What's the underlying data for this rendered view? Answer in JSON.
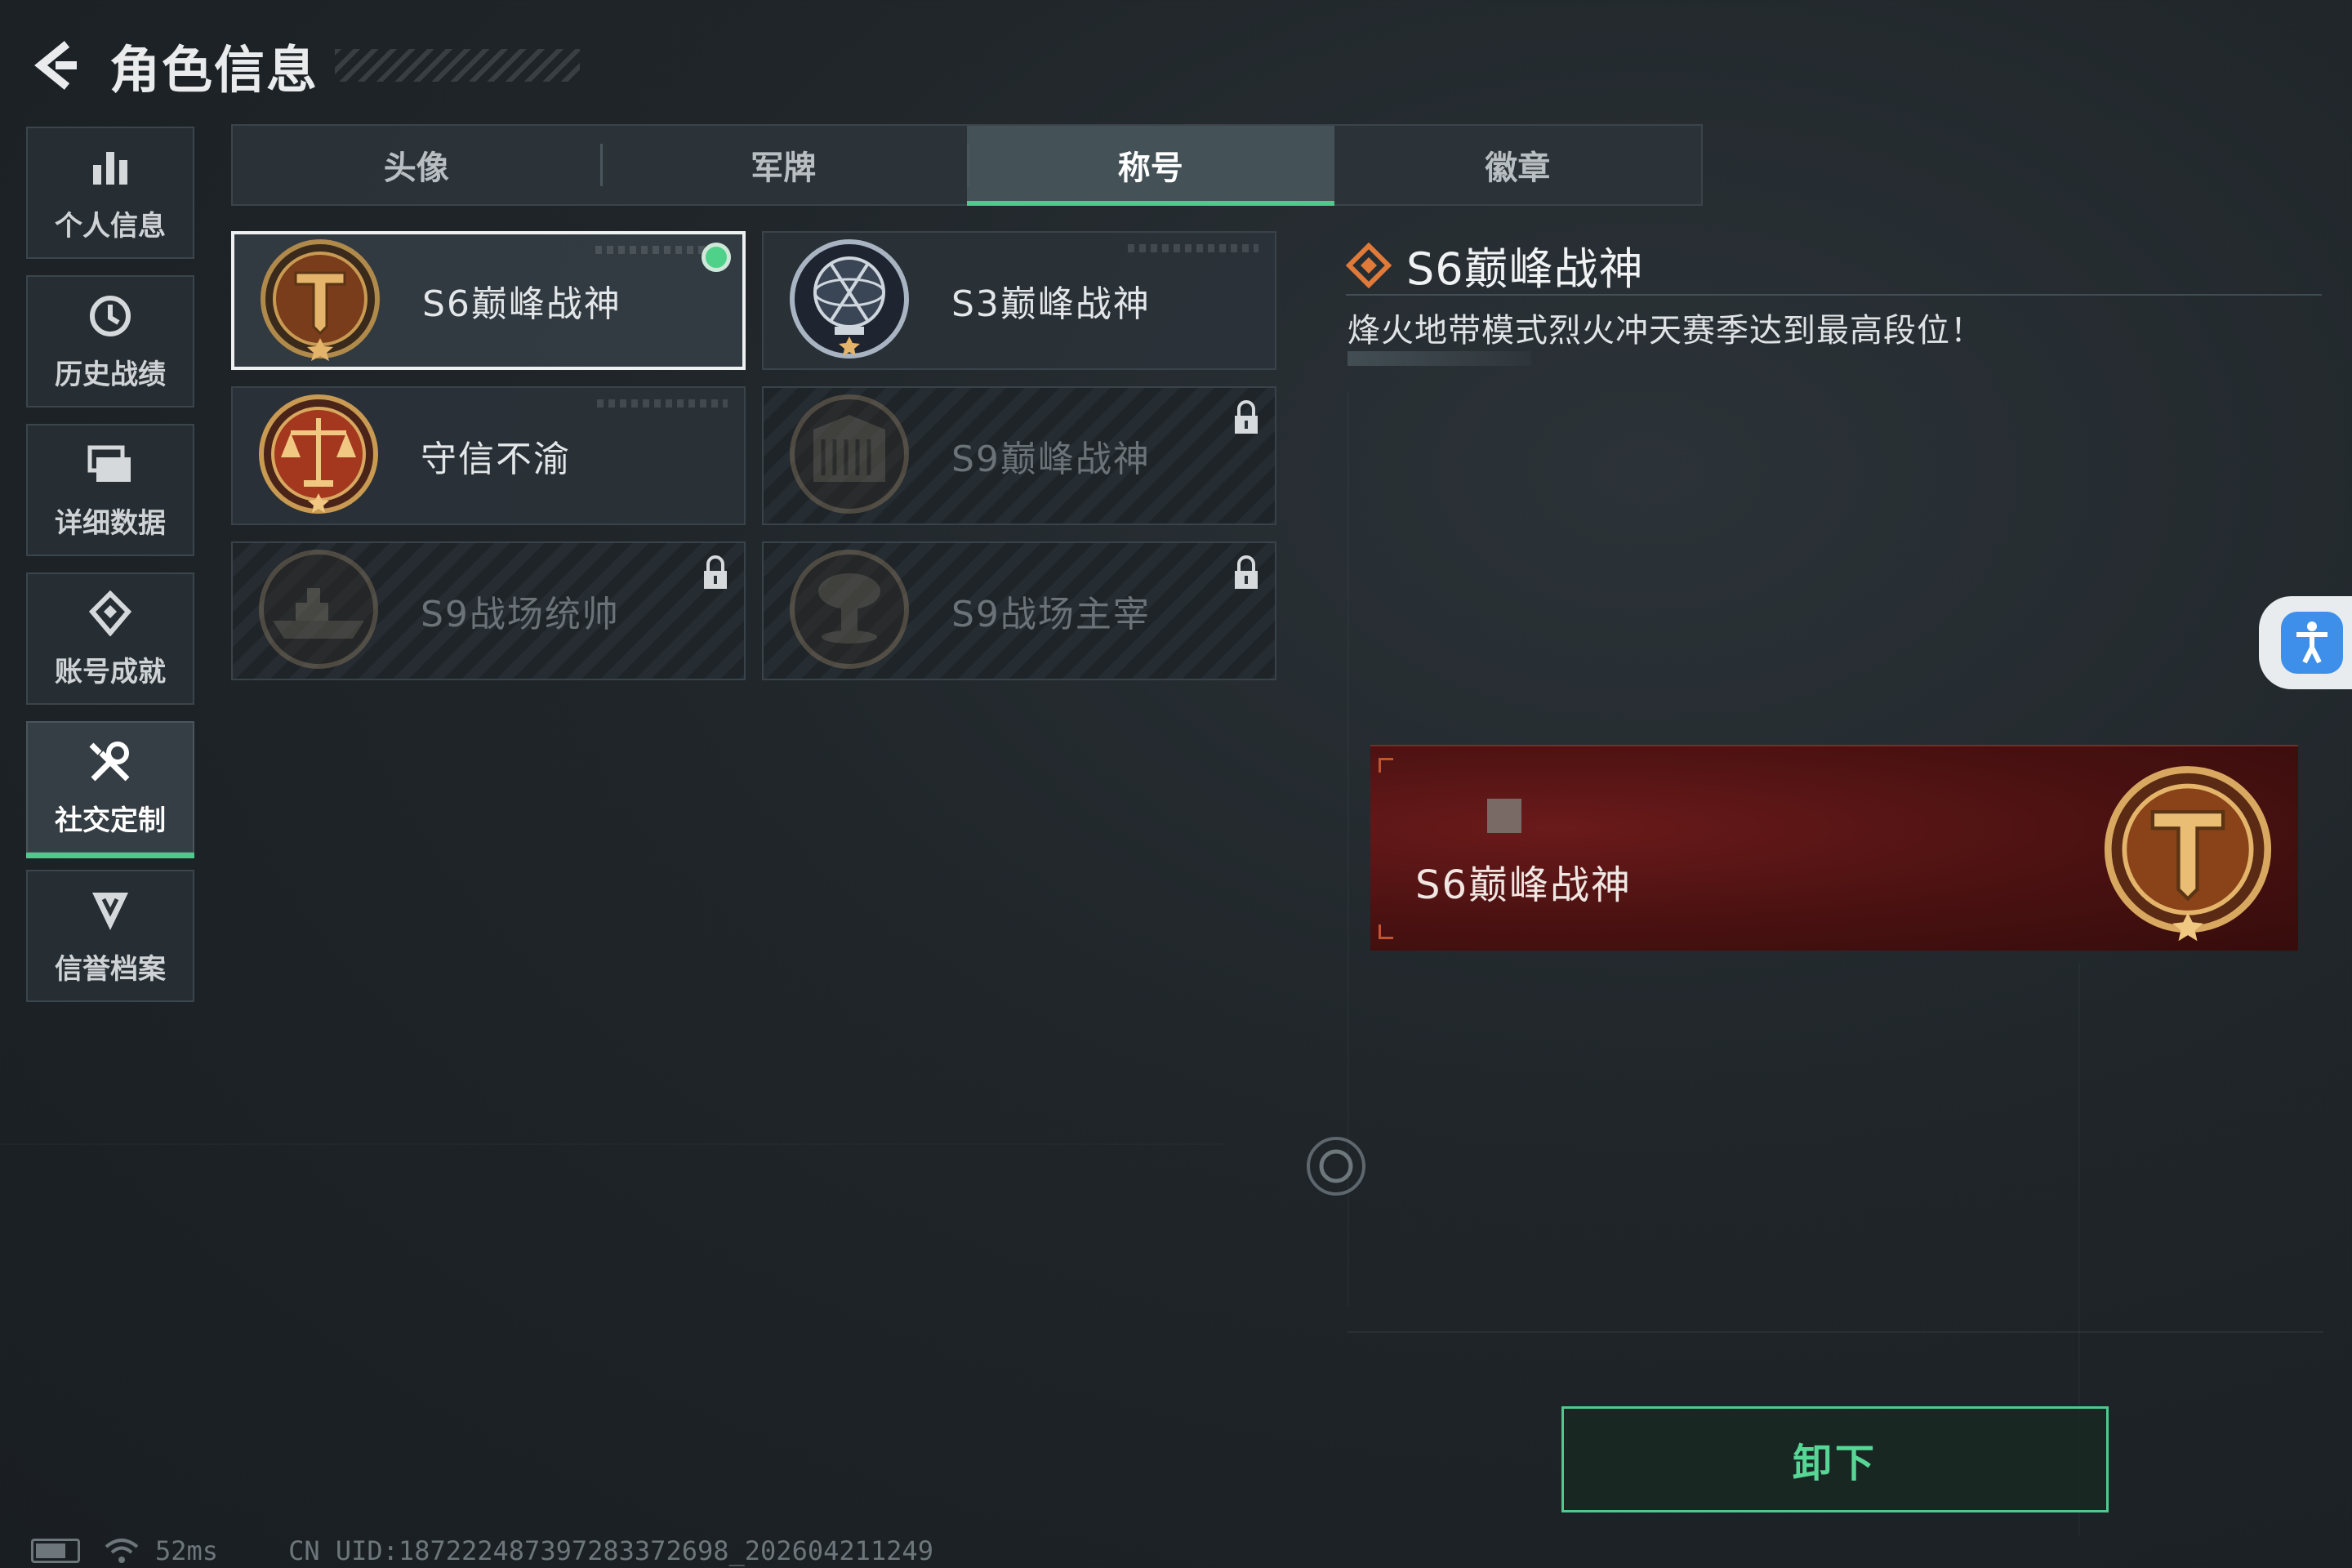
{
  "header": {
    "title": "角色信息"
  },
  "sidebar": {
    "items": [
      {
        "label": "个人信息",
        "icon": "bar-chart-icon",
        "active": false
      },
      {
        "label": "历史战绩",
        "icon": "history-clock-icon",
        "active": false
      },
      {
        "label": "详细数据",
        "icon": "folder-icon",
        "active": false
      },
      {
        "label": "账号成就",
        "icon": "achievement-icon",
        "active": false
      },
      {
        "label": "社交定制",
        "icon": "wrench-icon",
        "active": true
      },
      {
        "label": "信誉档案",
        "icon": "credit-shield-icon",
        "active": false
      }
    ]
  },
  "tabs": [
    {
      "label": "头像",
      "active": false
    },
    {
      "label": "军牌",
      "active": false
    },
    {
      "label": "称号",
      "active": true
    },
    {
      "label": "徽章",
      "active": false
    }
  ],
  "cards": [
    {
      "label": "S6巅峰战神",
      "emblem": "t-shield-emblem",
      "state": "selected",
      "equipped": true
    },
    {
      "label": "S3巅峰战神",
      "emblem": "globe-emblem",
      "state": "normal",
      "equipped": false
    },
    {
      "label": "守信不渝",
      "emblem": "scales-emblem",
      "state": "normal",
      "equipped": false
    },
    {
      "label": "S9巅峰战神",
      "emblem": "building-emblem",
      "state": "locked",
      "equipped": false
    },
    {
      "label": "S9战场统帅",
      "emblem": "warship-emblem",
      "state": "locked",
      "equipped": false
    },
    {
      "label": "S9战场主宰",
      "emblem": "mushroom-cloud-emblem",
      "state": "locked",
      "equipped": false
    }
  ],
  "detail": {
    "title": "S6巅峰战神",
    "description": "烽火地带模式烈火冲天赛季达到最高段位！",
    "preview_label": "S6巅峰战神",
    "action_label": "卸下"
  },
  "footer": {
    "ping": "52ms",
    "uid": "CN UID:18722248739728337​2698_202604211249"
  },
  "colors": {
    "accent": "#4fc98e",
    "preview_bg": "#4a1111"
  }
}
